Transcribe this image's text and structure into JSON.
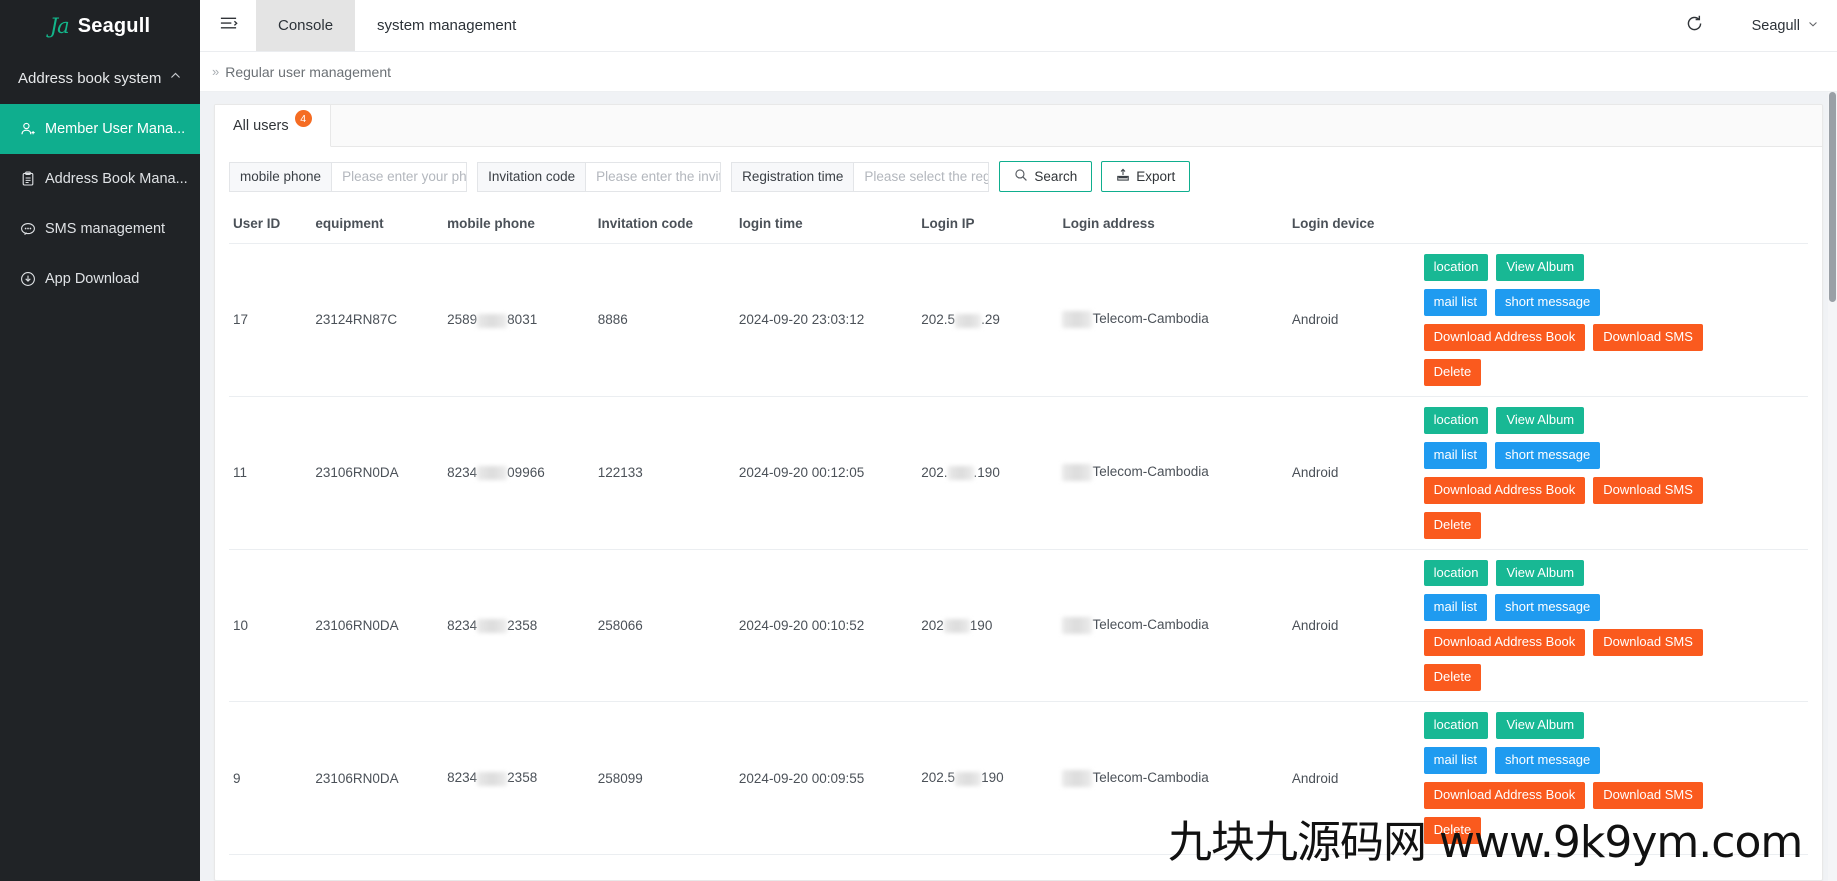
{
  "brand": {
    "logo_text": "Ja",
    "name": "Seagull"
  },
  "sidebar": {
    "group_label": "Address book system",
    "group_caret": "caret-up-icon",
    "items": [
      {
        "label": "Member User Mana...",
        "icon": "user-icon",
        "active": true
      },
      {
        "label": "Address Book Mana...",
        "icon": "clipboard-icon",
        "active": false
      },
      {
        "label": "SMS management",
        "icon": "message-icon",
        "active": false
      },
      {
        "label": "App Download",
        "icon": "download-circle-icon",
        "active": false
      }
    ]
  },
  "topbar": {
    "collapse_icon": "menu-collapse-icon",
    "tabs": [
      {
        "label": "Console",
        "selected": true
      },
      {
        "label": "system management",
        "selected": false
      }
    ],
    "refresh_icon": "refresh-icon",
    "user_name": "Seagull",
    "user_caret": "chevron-down-icon"
  },
  "breadcrumb": {
    "sep": "»",
    "title": "Regular user management"
  },
  "card_tabs": [
    {
      "label": "All users",
      "badge": "4",
      "active": true
    }
  ],
  "filters": [
    {
      "label": "mobile phone",
      "placeholder": "Please enter your phone",
      "value": ""
    },
    {
      "label": "Invitation code",
      "placeholder": "Please enter the invitatio",
      "value": ""
    },
    {
      "label": "Registration time",
      "placeholder": "Please select the registr",
      "value": ""
    }
  ],
  "buttons": {
    "search": {
      "label": "Search",
      "icon": "search-icon"
    },
    "export": {
      "label": "Export",
      "icon": "export-icon"
    }
  },
  "table": {
    "columns": [
      "User ID",
      "equipment",
      "mobile phone",
      "Invitation code",
      "login time",
      "Login IP",
      "Login address",
      "Login device",
      ""
    ],
    "rows": [
      {
        "user_id": "17",
        "equipment": "23124RN87C",
        "mobile_phone_prefix": "2589",
        "mobile_phone_suffix": "8031",
        "invitation_code": "8886",
        "login_time": "2024-09-20 23:03:12",
        "login_ip_prefix": "202.5",
        "login_ip_suffix": ".29",
        "login_address": "Telecom-Cambodia",
        "login_device": "Android"
      },
      {
        "user_id": "11",
        "equipment": "23106RN0DA",
        "mobile_phone_prefix": "8234",
        "mobile_phone_suffix": "09966",
        "invitation_code": "122133",
        "login_time": "2024-09-20 00:12:05",
        "login_ip_prefix": "202.",
        "login_ip_suffix": ".190",
        "login_address": "Telecom-Cambodia",
        "login_device": "Android"
      },
      {
        "user_id": "10",
        "equipment": "23106RN0DA",
        "mobile_phone_prefix": "8234",
        "mobile_phone_suffix": "2358",
        "invitation_code": "258066",
        "login_time": "2024-09-20 00:10:52",
        "login_ip_prefix": "202",
        "login_ip_suffix": "190",
        "login_address": "Telecom-Cambodia",
        "login_device": "Android"
      },
      {
        "user_id": "9",
        "equipment": "23106RN0DA",
        "mobile_phone_prefix": "8234",
        "mobile_phone_suffix": "2358",
        "invitation_code": "258099",
        "login_time": "2024-09-20 00:09:55",
        "login_ip_prefix": "202.5",
        "login_ip_suffix": "190",
        "login_address": "Telecom-Cambodia",
        "login_device": "Android"
      }
    ],
    "row_actions": [
      {
        "label": "location",
        "style": "teal"
      },
      {
        "label": "View Album",
        "style": "teal"
      },
      {
        "label": "mail list",
        "style": "blue"
      },
      {
        "label": "short message",
        "style": "blue"
      },
      {
        "label": "Download Address Book",
        "style": "orange"
      },
      {
        "label": "Download SMS",
        "style": "orange"
      },
      {
        "label": "Delete",
        "style": "orange"
      }
    ]
  },
  "watermark": "九块九源码网 www.9k9ym.com",
  "colors": {
    "sidebar_bg": "#1f2225",
    "active_nav": "#0fae8e",
    "badge": "#f56c23",
    "teal_btn": "#18b894",
    "blue_btn": "#1f9bf0",
    "orange_btn": "#fa5a1e",
    "page_bg": "#f0f2f5"
  }
}
